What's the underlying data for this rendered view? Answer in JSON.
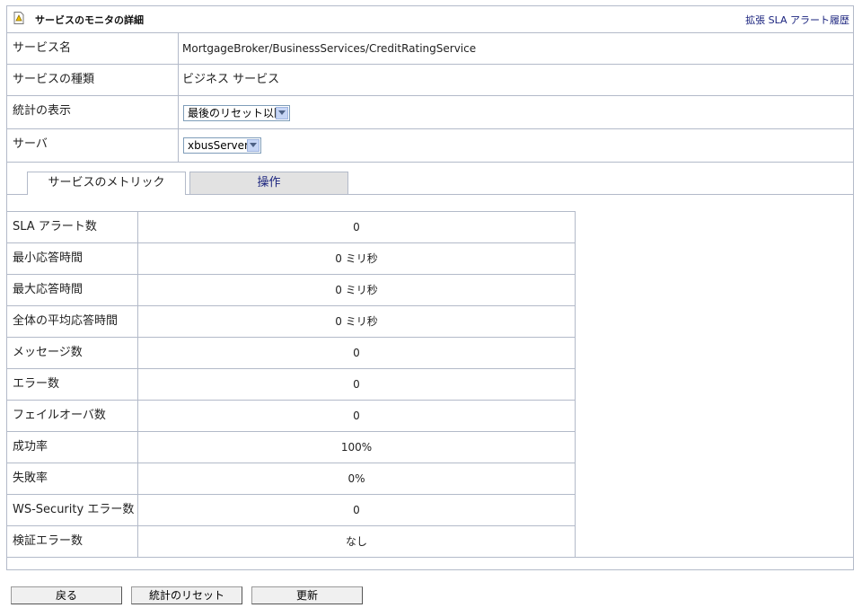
{
  "header": {
    "title": "サービスのモニタの詳細",
    "link": "拡張 SLA アラート履歴"
  },
  "info": [
    {
      "label": "サービス名",
      "value": "MortgageBroker/BusinessServices/CreditRatingService"
    },
    {
      "label": "サービスの種類",
      "value": "ビジネス サービス"
    },
    {
      "label": "統計の表示",
      "select": "最後のリセット以降"
    },
    {
      "label": "サーバ",
      "select": "xbusServer"
    }
  ],
  "tabs": [
    {
      "label": "サービスのメトリック",
      "active": true
    },
    {
      "label": "操作",
      "active": false
    }
  ],
  "metrics": [
    {
      "label": "SLA アラート数",
      "value": "0"
    },
    {
      "label": "最小応答時間",
      "value": "0 ミリ秒"
    },
    {
      "label": "最大応答時間",
      "value": "0 ミリ秒"
    },
    {
      "label": "全体の平均応答時間",
      "value": "0 ミリ秒"
    },
    {
      "label": "メッセージ数",
      "value": "0"
    },
    {
      "label": "エラー数",
      "value": "0"
    },
    {
      "label": "フェイルオーバ数",
      "value": "0"
    },
    {
      "label": "成功率",
      "value": "100%"
    },
    {
      "label": "失敗率",
      "value": "0%"
    },
    {
      "label": "WS-Security エラー数",
      "value": "0"
    },
    {
      "label": "検証エラー数",
      "value": "なし"
    }
  ],
  "buttons": {
    "back": "戻る",
    "reset": "統計のリセット",
    "refresh": "更新"
  },
  "colors": {
    "border": "#b3bac9",
    "link": "#1a237e",
    "inactive_tab": "#e2e2e2"
  }
}
